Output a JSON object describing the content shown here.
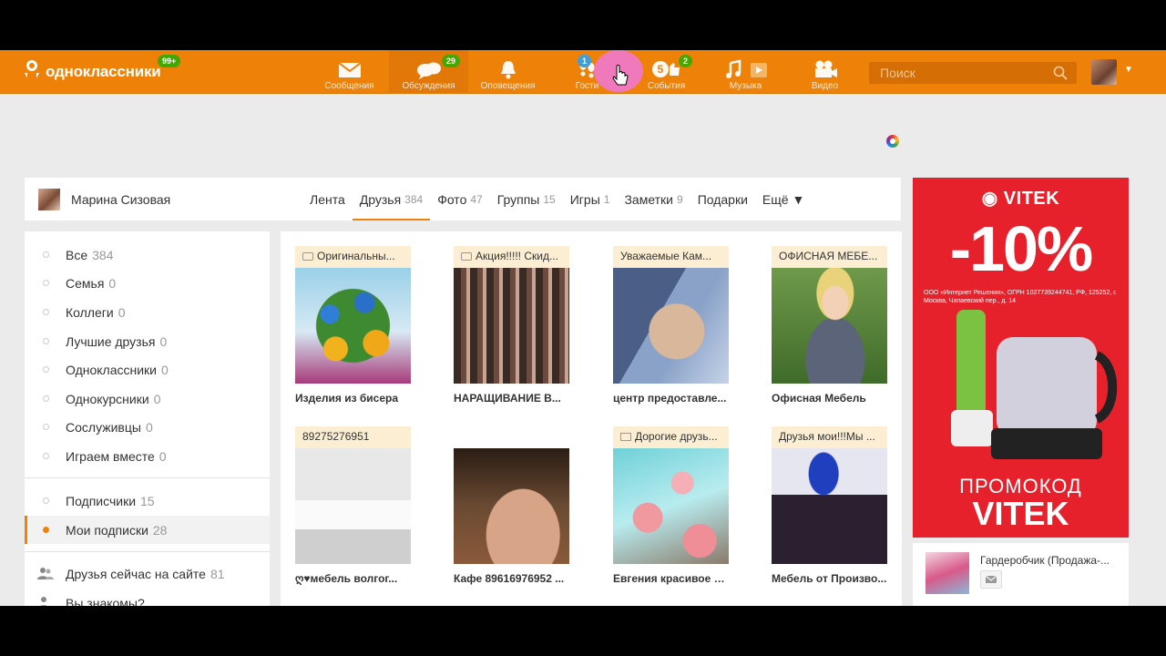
{
  "app": {
    "logo_text": "одноклассники",
    "logo_badge": "99+"
  },
  "nav": [
    {
      "label": "Сообщения",
      "icon": "envelope-icon",
      "badge": ""
    },
    {
      "label": "Обсуждения",
      "icon": "chat-bubbles-icon",
      "badge": "29"
    },
    {
      "label": "Оповещения",
      "icon": "bell-icon",
      "badge": ""
    },
    {
      "label": "Гости",
      "icon": "footprints-icon",
      "badge": "1"
    },
    {
      "label": "События",
      "icon": "events-icon",
      "badge": "2",
      "inline_count": "5"
    },
    {
      "label": "Музыка",
      "icon": "music-note-icon",
      "badge": ""
    },
    {
      "label": "Видео",
      "icon": "video-camera-icon",
      "badge": ""
    }
  ],
  "search": {
    "placeholder": "Поиск"
  },
  "profile": {
    "name": "Марина Сизовая"
  },
  "tabs": [
    {
      "label": "Лента",
      "count": ""
    },
    {
      "label": "Друзья",
      "count": "384",
      "active": true
    },
    {
      "label": "Фото",
      "count": "47"
    },
    {
      "label": "Группы",
      "count": "15"
    },
    {
      "label": "Игры",
      "count": "1"
    },
    {
      "label": "Заметки",
      "count": "9"
    },
    {
      "label": "Подарки",
      "count": ""
    },
    {
      "label": "Ещё ▼",
      "count": ""
    }
  ],
  "left_menu": {
    "group1": [
      {
        "label": "Все",
        "count": "384"
      },
      {
        "label": "Семья",
        "count": "0"
      },
      {
        "label": "Коллеги",
        "count": "0"
      },
      {
        "label": "Лучшие друзья",
        "count": "0"
      },
      {
        "label": "Одноклассники",
        "count": "0"
      },
      {
        "label": "Однокурсники",
        "count": "0"
      },
      {
        "label": "Сослуживцы",
        "count": "0"
      },
      {
        "label": "Играем вместе",
        "count": "0"
      }
    ],
    "group2": [
      {
        "label": "Подписчики",
        "count": "15"
      },
      {
        "label": "Мои подписки",
        "count": "28",
        "active": true
      }
    ],
    "group3": [
      {
        "label": "Друзья сейчас на сайте",
        "count": "81"
      },
      {
        "label": "Вы знакомы?",
        "count": ""
      }
    ]
  },
  "cards": [
    {
      "tag": "Оригинальны...",
      "title": "Изделия из бисера"
    },
    {
      "tag": "Акция!!!!! Скид...",
      "title": "НАРАЩИВАНИЕ В..."
    },
    {
      "tag": "Уважаемые Кам...",
      "title": "центр предоставле..."
    },
    {
      "tag": "ОФИСНАЯ МЕБЕ...",
      "title": "Офисная Мебель"
    },
    {
      "tag": "89275276951",
      "title": "ღ♥мебель волгог..."
    },
    {
      "tag": "",
      "title": "Кафе 89616976952 ..."
    },
    {
      "tag": "Дорогие друзь...",
      "title": "Евгения красивое п..."
    },
    {
      "tag": "Друзья мои!!!Мы ...",
      "title": "Мебель от Произво..."
    }
  ],
  "ad": {
    "brand": "VITEK",
    "discount": "-10%",
    "legal": "ООО «Интернет Решения», ОГРН 1027739244741, РФ, 125252, г. Москва, Чапаевский пер., д. 14",
    "promo_line1": "ПРОМОКОД",
    "promo_line2": "VITEK"
  },
  "aside": {
    "group_name": "Гардеробчик (Продажа-..."
  },
  "colors": {
    "brand_orange": "#ee8208",
    "badge_green": "#40a800",
    "ad_red": "#e6212b"
  }
}
